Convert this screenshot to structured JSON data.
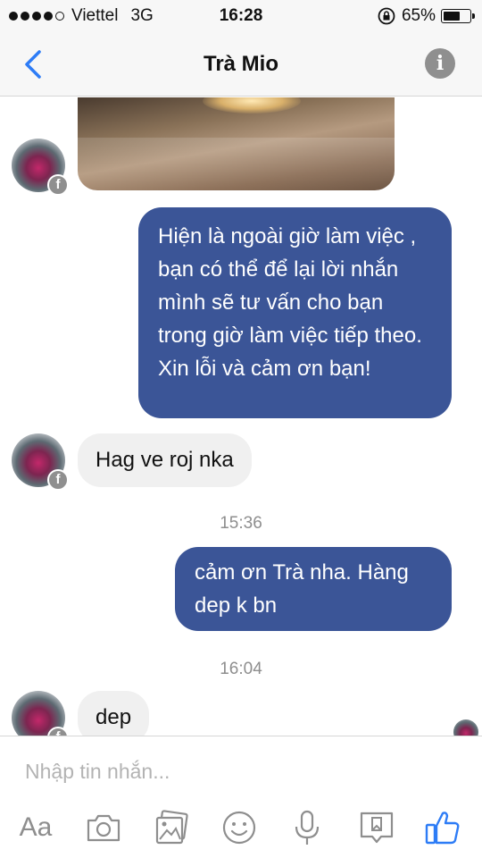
{
  "status_bar": {
    "carrier": "Viettel",
    "network": "3G",
    "time": "16:28",
    "battery": "65%",
    "battery_level": 0.65,
    "signal_bars": 4
  },
  "header": {
    "title": "Trà Mio",
    "back_icon": "chevron-left-icon",
    "info_icon": "info-icon"
  },
  "messages": [
    {
      "sender": "contact",
      "type": "photo"
    },
    {
      "sender": "me",
      "text": "Hiện là ngoài giờ làm việc , bạn có thể để lại lời nhắn mình sẽ tư vấn cho bạn trong giờ làm việc tiếp theo. Xin lỗi và cảm ơn bạn!"
    },
    {
      "sender": "contact",
      "text": "Hag ve roj nka"
    },
    {
      "type": "timestamp",
      "text": "15:36"
    },
    {
      "sender": "me",
      "text": "cảm ơn Trà nha. Hàng dep k bn"
    },
    {
      "type": "timestamp",
      "text": "16:04"
    },
    {
      "sender": "contact",
      "text": "dep"
    }
  ],
  "composer": {
    "placeholder": "Nhập tin nhắn...",
    "aa_label": "Aa",
    "tools": [
      "camera-icon",
      "gallery-icon",
      "sticker-icon",
      "microphone-icon",
      "more-icon",
      "like-icon"
    ]
  },
  "colors": {
    "accent": "#3b5597",
    "blue_icon": "#2d7cf6",
    "incoming_bubble": "#f0f0f0",
    "grey_icon": "#8e8e8e"
  }
}
